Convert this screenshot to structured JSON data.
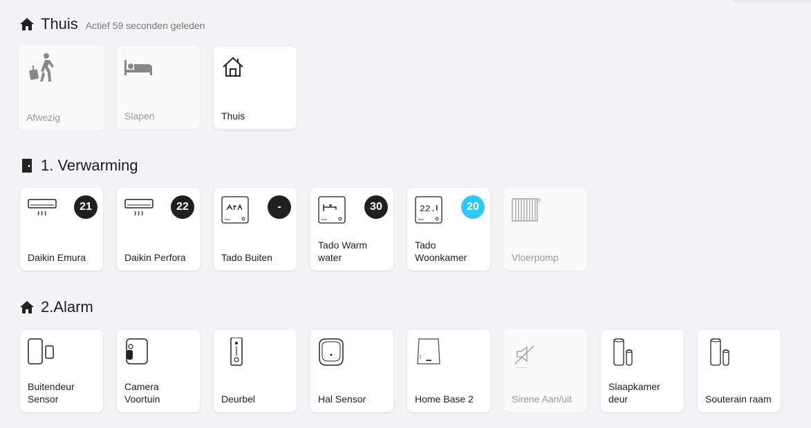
{
  "sections": {
    "thuis": {
      "title": "Thuis",
      "subtitle": "Actief 59 seconden geleden"
    },
    "verwarming": {
      "title": "1. Verwarming"
    },
    "alarm": {
      "title": "2.Alarm"
    }
  },
  "modes": [
    {
      "label": "Afwezig",
      "icon": "person-walking-luggage-icon",
      "active": false
    },
    {
      "label": "Slapen",
      "icon": "bed-icon",
      "active": false
    },
    {
      "label": "Thuis",
      "icon": "house-icon",
      "active": true
    }
  ],
  "heating": [
    {
      "label": "Daikin Emura",
      "icon": "airco-icon",
      "value": "21"
    },
    {
      "label": "Daikin Perfora",
      "icon": "airco-icon",
      "value": "22"
    },
    {
      "label": "Tado Buiten",
      "icon": "tado-thermostat-icon",
      "value": "-"
    },
    {
      "label": "Tado Warm water",
      "icon": "tado-tap-icon",
      "value": "30"
    },
    {
      "label": "Tado Woonkamer",
      "icon": "tado-display-icon",
      "value": "20",
      "badge_color": "#2ec8f4"
    },
    {
      "label": "Vloerpomp",
      "icon": "radiator-icon"
    }
  ],
  "alarm": [
    {
      "label": "Buitendeur Sensor",
      "icon": "door-sensor-icon"
    },
    {
      "label": "Camera Voortuin",
      "icon": "camera-icon"
    },
    {
      "label": "Deurbel",
      "icon": "doorbell-icon"
    },
    {
      "label": "Hal Sensor",
      "icon": "motion-sensor-icon"
    },
    {
      "label": "Home Base 2",
      "icon": "home-base-icon"
    },
    {
      "label": "Sirene Aan/uit",
      "icon": "siren-muted-icon"
    },
    {
      "label": "Slaapkamer deur",
      "icon": "contact-sensor-icon"
    },
    {
      "label": "Souterain raam",
      "icon": "contact-sensor-icon"
    }
  ],
  "colors": {
    "badge_dark": "#1f1f1f",
    "badge_blue": "#2ec8f4",
    "background": "#f4f4f6"
  }
}
